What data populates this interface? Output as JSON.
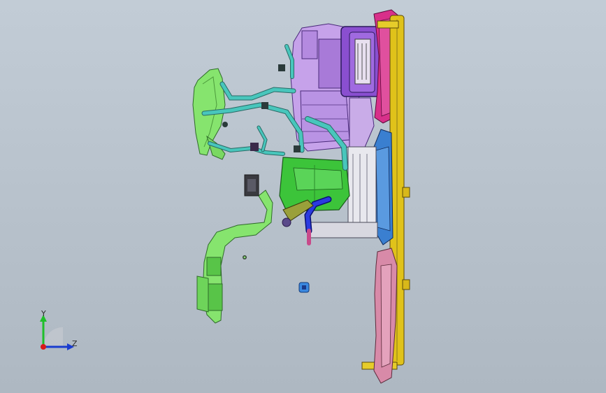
{
  "viewport": {
    "background_top": "#c2ccd6",
    "background_bottom": "#aeb8c2"
  },
  "triad": {
    "y_label": "Y",
    "z_label": "Z",
    "colors": {
      "y_axis": "#1fbf2a",
      "z_axis": "#1a3ccf",
      "x_axis": "#d81a1a"
    }
  },
  "model": {
    "part_colors": {
      "bracket_green": "#7ee06a",
      "tank_green": "#3cc43a",
      "hose_teal": "#3fb8b0",
      "housing_violet": "#b48ae0",
      "housing_purple": "#8a4fd0",
      "frame_yellow": "#e0c21a",
      "blower_magenta": "#d8308a",
      "duct_pink": "#d88aa8",
      "fan_blue": "#3a7fd0",
      "pipe_blue": "#1a2ad0",
      "clip_blue": "#3a88e0"
    }
  }
}
